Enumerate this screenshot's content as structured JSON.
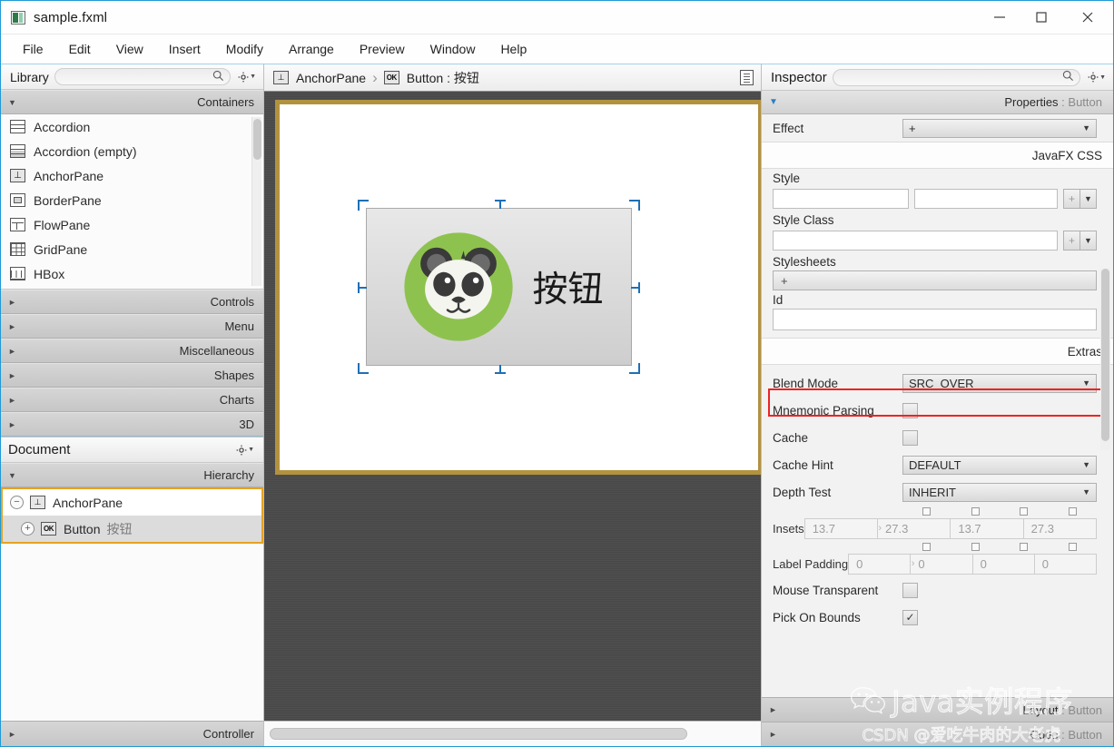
{
  "window": {
    "title": "sample.fxml",
    "icon": "fxml-file-icon",
    "controls": {
      "minimize": "minimize-icon",
      "maximize": "maximize-icon",
      "close": "close-icon"
    }
  },
  "menubar": {
    "items": [
      "File",
      "Edit",
      "View",
      "Insert",
      "Modify",
      "Arrange",
      "Preview",
      "Window",
      "Help"
    ]
  },
  "library": {
    "title": "Library",
    "search_placeholder": "",
    "search_value": "",
    "sections": [
      {
        "label": "Containers",
        "expanded": true
      },
      {
        "label": "Controls",
        "expanded": false
      },
      {
        "label": "Menu",
        "expanded": false
      },
      {
        "label": "Miscellaneous",
        "expanded": false
      },
      {
        "label": "Shapes",
        "expanded": false
      },
      {
        "label": "Charts",
        "expanded": false
      },
      {
        "label": "3D",
        "expanded": false
      }
    ],
    "items": [
      {
        "label": "Accordion",
        "icon": "accordion-icon"
      },
      {
        "label": "Accordion  (empty)",
        "icon": "accordion-empty-icon"
      },
      {
        "label": "AnchorPane",
        "icon": "anchorpane-icon"
      },
      {
        "label": "BorderPane",
        "icon": "borderpane-icon"
      },
      {
        "label": "FlowPane",
        "icon": "flowpane-icon"
      },
      {
        "label": "GridPane",
        "icon": "gridpane-icon"
      },
      {
        "label": "HBox",
        "icon": "hbox-icon"
      }
    ]
  },
  "document": {
    "title": "Document",
    "hierarchy_label": "Hierarchy",
    "controller_label": "Controller",
    "tree": [
      {
        "label": "AnchorPane",
        "sub": "",
        "icon": "anchorpane-icon",
        "toggle": "minus",
        "selected": true
      },
      {
        "label": "Button",
        "sub": "按钮",
        "icon": "button-ok-icon",
        "toggle": "plus",
        "selected": true
      }
    ]
  },
  "breadcrumb": {
    "root": "AnchorPane",
    "separator": "›",
    "leaf": "Button : 按钮",
    "root_icon": "anchorpane-icon",
    "leaf_icon": "button-ok-icon",
    "doc_icon": "document-icon"
  },
  "canvas": {
    "anchorpane_border_color": "#b3923f",
    "background_color": "#4a4a4a",
    "button": {
      "label": "按钮",
      "graphic": "panda-icon",
      "graphic_colors": {
        "circle": "#8ec24f",
        "face": "#f5f5f0",
        "dark": "#3a3a3a",
        "ear_inner": "#6b6b6b"
      },
      "selected": true
    }
  },
  "inspector": {
    "title": "Inspector",
    "search_value": "",
    "properties_bar": {
      "prefix": "Properties",
      "target": "Button"
    },
    "effect": {
      "label": "Effect",
      "value": "+"
    },
    "javafx_css_label": "JavaFX CSS",
    "style": {
      "label": "Style",
      "value1": "",
      "value2": "",
      "plus": "+"
    },
    "style_class": {
      "label": "Style Class",
      "value": "",
      "plus": "+"
    },
    "stylesheets": {
      "label": "Stylesheets",
      "value": "+"
    },
    "id": {
      "label": "Id",
      "value": ""
    },
    "extras_label": "Extras",
    "blend_mode": {
      "label": "Blend Mode",
      "value": "SRC_OVER"
    },
    "mnemonic_parsing": {
      "label": "Mnemonic Parsing",
      "checked": false
    },
    "cache": {
      "label": "Cache",
      "checked": false
    },
    "cache_hint": {
      "label": "Cache Hint",
      "value": "DEFAULT"
    },
    "depth_test": {
      "label": "Depth Test",
      "value": "INHERIT"
    },
    "insets": {
      "label": "Insets",
      "values": [
        "13.7",
        "27.3",
        "13.7",
        "27.3"
      ],
      "highlighted": true,
      "highlight_color": "#ee2222"
    },
    "label_padding": {
      "label": "Label Padding",
      "values": [
        "0",
        "0",
        "0",
        "0"
      ]
    },
    "mouse_transparent": {
      "label": "Mouse Transparent",
      "checked": false
    },
    "pick_on_bounds": {
      "label": "Pick On Bounds",
      "checked": true
    },
    "footer_sections": [
      {
        "prefix": "Layout",
        "target": "Button"
      },
      {
        "prefix": "Code",
        "target": "Button"
      }
    ]
  },
  "watermark": {
    "line1": "Java实例程序",
    "line2": "CSDN @爱吃牛肉的大老虎",
    "icon": "wechat-icon"
  }
}
